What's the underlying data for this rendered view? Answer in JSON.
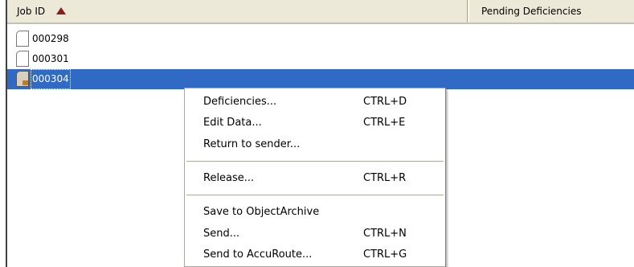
{
  "list": {
    "columns": [
      {
        "label": "Job ID",
        "sort": "ascending"
      },
      {
        "label": "Pending Deficiencies"
      }
    ],
    "rows": [
      {
        "job_id": "000298",
        "icon": "document-icon",
        "selected": false
      },
      {
        "job_id": "000301",
        "icon": "document-icon",
        "selected": false
      },
      {
        "job_id": "000304",
        "icon": "locked-document-icon",
        "selected": true
      }
    ]
  },
  "context_menu": {
    "items": [
      {
        "label": "Deficiencies...",
        "shortcut": "CTRL+D"
      },
      {
        "label": "Edit Data...",
        "shortcut": "CTRL+E"
      },
      {
        "label": "Return to sender...",
        "shortcut": ""
      },
      {
        "label": "Release...",
        "shortcut": "CTRL+R"
      },
      {
        "label": "Save to ObjectArchive",
        "shortcut": ""
      },
      {
        "label": "Send...",
        "shortcut": "CTRL+N"
      },
      {
        "label": "Send to AccuRoute...",
        "shortcut": "CTRL+G"
      }
    ]
  },
  "colors": {
    "selection": "#316ac5",
    "header_bg": "#ece9d8",
    "sort_arrow": "#8b1d1d"
  }
}
